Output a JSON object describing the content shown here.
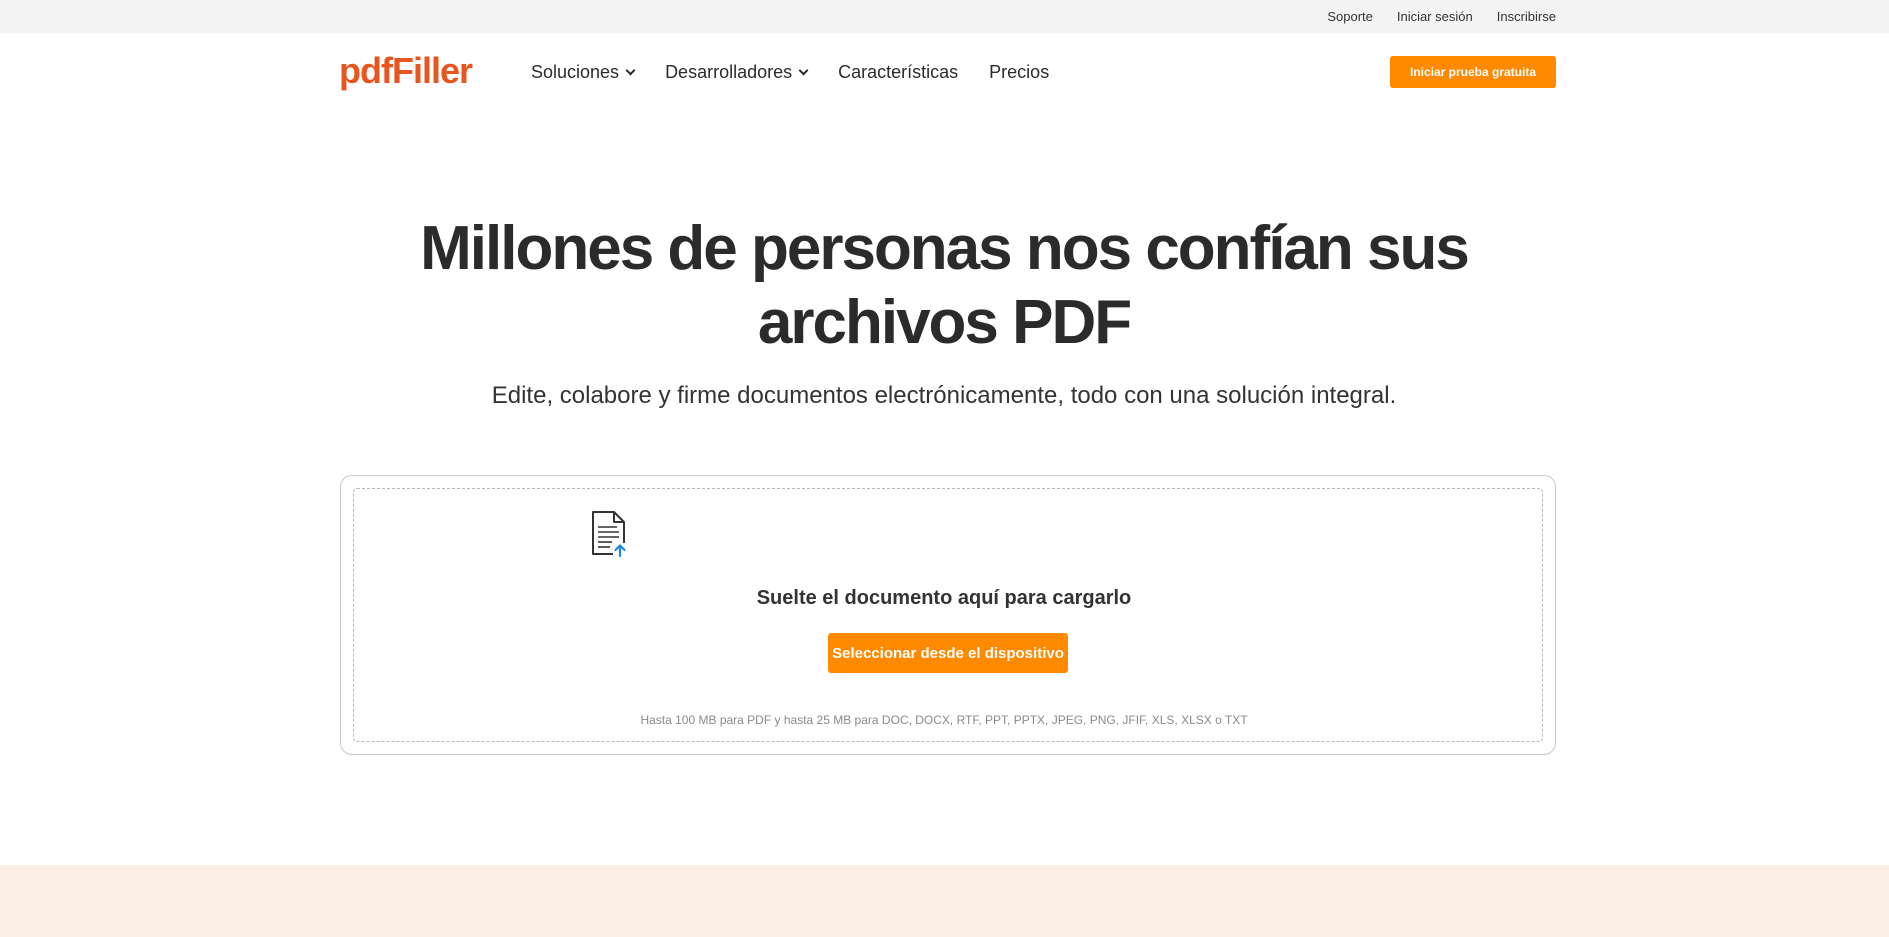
{
  "topbar": {
    "links": [
      "Soporte",
      "Iniciar sesión",
      "Inscribirse"
    ]
  },
  "header": {
    "logo": "pdfFiller",
    "nav": [
      {
        "label": "Soluciones",
        "dropdown": true
      },
      {
        "label": "Desarrolladores",
        "dropdown": true
      },
      {
        "label": "Características",
        "dropdown": false
      },
      {
        "label": "Precios",
        "dropdown": false
      }
    ],
    "cta_label": "Iniciar prueba gratuita"
  },
  "hero": {
    "title_line1": "Millones de personas nos confían sus",
    "title_line2": "archivos PDF",
    "subtitle": "Edite, colabore y firme documentos electrónicamente, todo con una solución integral."
  },
  "upload": {
    "icon": "document-upload-icon",
    "drop_text": "Suelte el documento aquí para cargarlo",
    "select_label": "Seleccionar desde el dispositivo",
    "limits": "Hasta 100 MB para PDF y hasta 25 MB para DOC, DOCX, RTF, PPT, PPTX, JPEG, PNG, JFIF, XLS, XLSX o TXT"
  },
  "colors": {
    "brand": "#e8561f",
    "accent": "#ff8a00",
    "upload_arrow": "#1e88e5",
    "bottom_band": "#fcefe6"
  }
}
